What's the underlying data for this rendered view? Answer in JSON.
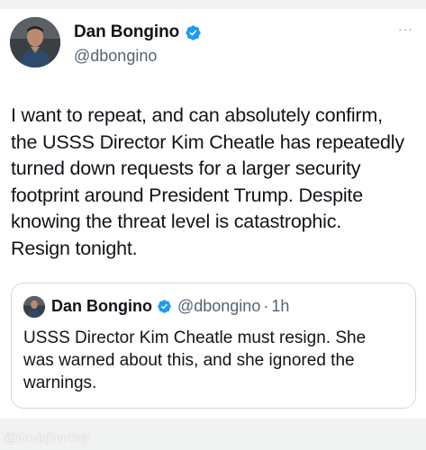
{
  "tweet": {
    "author": {
      "display_name": "Dan Bongino",
      "handle": "@dbongino",
      "verified_icon": "verified-badge-icon",
      "avatar_icon": "user-avatar"
    },
    "more_label": "···",
    "text_lines": [
      "I want to repeat, and can absolutely confirm,",
      "the USSS Director Kim Cheatle has repeatedly",
      "turned down requests for a larger security",
      "footprint around President Trump. Despite",
      "knowing the threat level is catastrophic.",
      "Resign tonight."
    ],
    "quote": {
      "display_name": "Dan Bongino",
      "handle": "@dbongino",
      "separator": "·",
      "time": "1h",
      "text_lines": [
        "USSS Director Kim Cheatle must resign. She",
        "was warned about this, and she ignored the",
        "warnings."
      ]
    }
  },
  "watermark": "@davidjharrisjr",
  "colors": {
    "background": "#f1f2f2",
    "card": "#ffffff",
    "text": "#0f1419",
    "secondary_text": "#536471",
    "verified": "#1d9bf0",
    "quote_border": "#cfd9de"
  }
}
